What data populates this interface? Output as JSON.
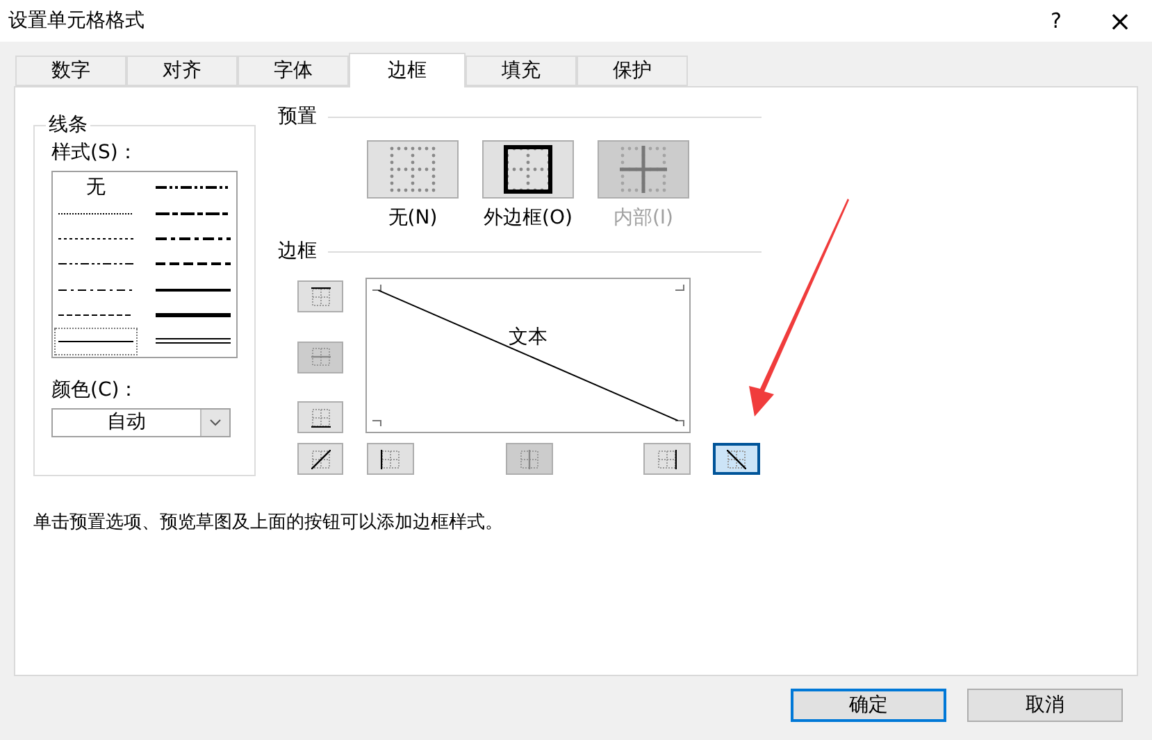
{
  "window": {
    "title": "设置单元格格式",
    "help": "?",
    "close": "×"
  },
  "tabs": [
    {
      "label": "数字",
      "selected": false
    },
    {
      "label": "对齐",
      "selected": false
    },
    {
      "label": "字体",
      "selected": false
    },
    {
      "label": "边框",
      "selected": true
    },
    {
      "label": "填充",
      "selected": false
    },
    {
      "label": "保护",
      "selected": false
    }
  ],
  "line": {
    "title": "线条",
    "style_label": "样式(S)：",
    "styles": [
      {
        "kind": "none",
        "label": "无",
        "selected": false
      },
      {
        "kind": "hair",
        "selected": false
      },
      {
        "kind": "dotted",
        "selected": false
      },
      {
        "kind": "dashdotdot",
        "selected": false
      },
      {
        "kind": "dashdot",
        "selected": false
      },
      {
        "kind": "dashed",
        "selected": false
      },
      {
        "kind": "thin",
        "selected": true
      },
      {
        "kind": "mediumdashdotdot",
        "selected": false
      },
      {
        "kind": "slantdashdot",
        "selected": false
      },
      {
        "kind": "mediumdashdot",
        "selected": false
      },
      {
        "kind": "mediumdashed",
        "selected": false
      },
      {
        "kind": "medium",
        "selected": false
      },
      {
        "kind": "thick",
        "selected": false
      },
      {
        "kind": "double",
        "selected": false
      }
    ],
    "color_label": "颜色(C)：",
    "color_value": "自动"
  },
  "presets": {
    "title": "预置",
    "items": [
      {
        "kind": "none",
        "label": "无(N)",
        "disabled": false
      },
      {
        "kind": "outline",
        "label": "外边框(O)",
        "disabled": false
      },
      {
        "kind": "inside",
        "label": "内部(I)",
        "disabled": true
      }
    ]
  },
  "border": {
    "title": "边框",
    "preview_text": "文本",
    "buttons": [
      {
        "kind": "top",
        "selected": false,
        "disabled": false
      },
      {
        "kind": "middle",
        "selected": false,
        "disabled": true
      },
      {
        "kind": "bottom",
        "selected": false,
        "disabled": false
      },
      {
        "kind": "diag_up",
        "selected": false,
        "disabled": false
      },
      {
        "kind": "left",
        "selected": false,
        "disabled": false
      },
      {
        "kind": "center",
        "selected": false,
        "disabled": true
      },
      {
        "kind": "right",
        "selected": false,
        "disabled": false
      },
      {
        "kind": "diag_down",
        "selected": true,
        "disabled": false
      }
    ]
  },
  "hint": "单击预置选项、预览草图及上面的按钮可以添加边框样式。",
  "buttons": [
    {
      "label": "确定",
      "kind": "default"
    },
    {
      "label": "取消",
      "kind": "normal"
    }
  ]
}
